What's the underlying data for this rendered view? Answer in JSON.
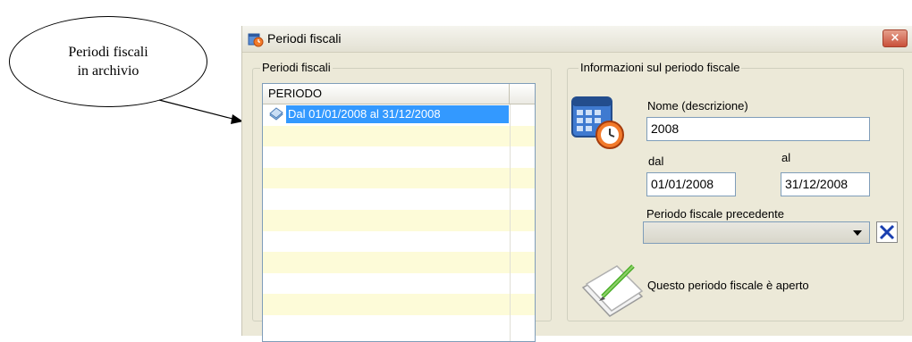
{
  "callout": {
    "line1": "Periodi fiscali",
    "line2": "in archivio"
  },
  "window": {
    "title": "Periodi fiscali",
    "close_label": "×"
  },
  "list_group": {
    "label": "Periodi fiscali",
    "column_header": "PERIODO",
    "rows": [
      {
        "text": "Dal 01/01/2008 al 31/12/2008",
        "selected": true
      }
    ]
  },
  "info_group": {
    "label": "Informazioni sul periodo fiscale",
    "name_label": "Nome (descrizione)",
    "name_value": "2008",
    "dal_label": "dal",
    "dal_value": "01/01/2008",
    "al_label": "al",
    "al_value": "31/12/2008",
    "prev_label": "Periodo fiscale precedente",
    "prev_value": "",
    "status_text": "Questo periodo fiscale è aperto"
  },
  "icons": {
    "app": "app-calendar-icon",
    "row": "period-item-icon",
    "calendar": "calendar-clock-icon",
    "note": "notepad-pencil-icon",
    "clear": "clear-x-icon",
    "dropdown": "chevron-down-icon"
  },
  "colors": {
    "selection": "#3399ff",
    "alt_row": "#fdfbd8",
    "window_bg": "#ece9d8",
    "close_btn": "#c9503a"
  }
}
